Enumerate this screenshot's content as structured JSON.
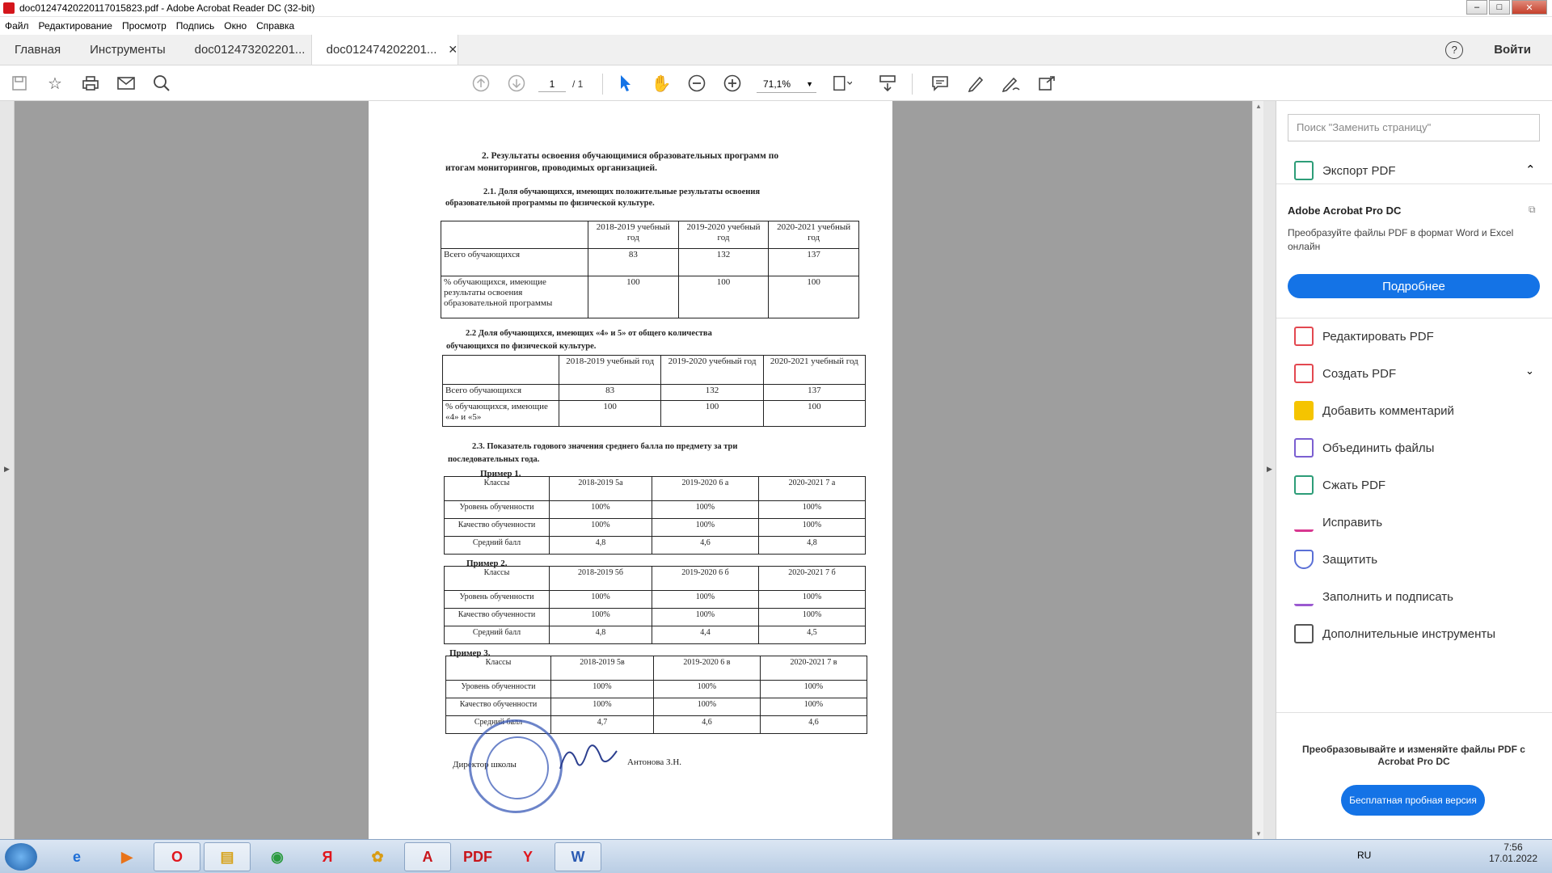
{
  "window": {
    "title": "doc01247420220117015823.pdf - Adobe Acrobat Reader DC (32-bit)"
  },
  "menu": [
    "Файл",
    "Редактирование",
    "Просмотр",
    "Подпись",
    "Окно",
    "Справка"
  ],
  "tabs": {
    "home": "Главная",
    "tools": "Инструменты",
    "doc1": "doc012473202201...",
    "doc2": "doc012474202201...",
    "signin": "Войти"
  },
  "toolbar": {
    "page_current": "1",
    "page_total": "/ 1",
    "zoom": "71,1%"
  },
  "document": {
    "heading2": "2. Результаты освоения обучающимися образовательных программ по",
    "heading2b": "итогам мониторингов, проводимых организацией.",
    "heading21": "2.1. Доля обучающихся, имеющих положительные результаты освоения",
    "heading21b": "образовательной программы по физической культуре.",
    "table1": {
      "headers": [
        "",
        "2018-2019 учебный год",
        "2019-2020 учебный год",
        "2020-2021 учебный год"
      ],
      "rows": [
        [
          "Всего обучающихся",
          "83",
          "132",
          "137"
        ],
        [
          "% обучающихся, имеющие результаты освоения образовательной программы",
          "100",
          "100",
          "100"
        ]
      ]
    },
    "heading22": "2.2    Доля обучающихся, имеющих «4» и 5» от общего количества",
    "heading22b": "обучающихся по физической культуре.",
    "table2": {
      "headers": [
        "",
        "2018-2019 учебный год",
        "2019-2020 учебный год",
        "2020-2021 учебный год"
      ],
      "rows": [
        [
          "Всего обучающихся",
          "83",
          "132",
          "137"
        ],
        [
          "% обучающихся, имеющие «4» и «5»",
          "100",
          "100",
          "100"
        ]
      ]
    },
    "heading23": "2.3.  Показатель годового значения среднего балла по предмету за три",
    "heading23b": "последовательных года.",
    "examples": [
      {
        "label": "Пример 1.",
        "headers": [
          "Классы",
          "2018-2019 5а",
          "2019-2020 6 а",
          "2020-2021 7 а"
        ],
        "rows": [
          [
            "Уровень обученности",
            "100%",
            "100%",
            "100%"
          ],
          [
            "Качество обученности",
            "100%",
            "100%",
            "100%"
          ],
          [
            "Средний балл",
            "4,8",
            "4,6",
            "4,8"
          ]
        ]
      },
      {
        "label": "Пример 2.",
        "headers": [
          "Классы",
          "2018-2019 5б",
          "2019-2020 6 б",
          "2020-2021 7 б"
        ],
        "rows": [
          [
            "Уровень обученности",
            "100%",
            "100%",
            "100%"
          ],
          [
            "Качество обученности",
            "100%",
            "100%",
            "100%"
          ],
          [
            "Средний балл",
            "4,8",
            "4,4",
            "4,5"
          ]
        ]
      },
      {
        "label": "Пример 3.",
        "headers": [
          "Классы",
          "2018-2019 5в",
          "2019-2020 6 в",
          "2020-2021 7 в"
        ],
        "rows": [
          [
            "Уровень обученности",
            "100%",
            "100%",
            "100%"
          ],
          [
            "Качество обученности",
            "100%",
            "100%",
            "100%"
          ],
          [
            "Средний балл",
            "4,7",
            "4,6",
            "4,6"
          ]
        ]
      }
    ],
    "signer_title": "Директор школы",
    "signer_name": "Антонова З.Н."
  },
  "sidebar": {
    "search_placeholder": "Поиск \"Заменить страницу\"",
    "export": "Экспорт PDF",
    "promo_title": "Adobe Acrobat Pro DC",
    "promo_text": "Преобразуйте файлы PDF в формат Word и Excel онлайн",
    "promo_button": "Подробнее",
    "tools": [
      {
        "label": "Редактировать PDF",
        "icon": "edit-pdf-icon",
        "color": "#e34850"
      },
      {
        "label": "Создать PDF",
        "icon": "create-pdf-icon",
        "color": "#e34850"
      },
      {
        "label": "Добавить комментарий",
        "icon": "comment-icon",
        "color": "#f5c400"
      },
      {
        "label": "Объединить файлы",
        "icon": "combine-icon",
        "color": "#7b5fd1"
      },
      {
        "label": "Сжать PDF",
        "icon": "compress-icon",
        "color": "#2d9d78"
      },
      {
        "label": "Исправить",
        "icon": "redact-icon",
        "color": "#d83790"
      },
      {
        "label": "Защитить",
        "icon": "protect-icon",
        "color": "#5a6fd6"
      },
      {
        "label": "Заполнить и подписать",
        "icon": "fill-sign-icon",
        "color": "#9b59d0"
      },
      {
        "label": "Дополнительные инструменты",
        "icon": "more-tools-icon",
        "color": "#555555"
      }
    ],
    "footer_text": "Преобразовывайте и изменяйте файлы PDF с Acrobat Pro DC",
    "footer_button": "Бесплатная пробная версия"
  },
  "taskbar": {
    "lang": "RU",
    "time": "7:56",
    "date": "17.01.2022"
  }
}
